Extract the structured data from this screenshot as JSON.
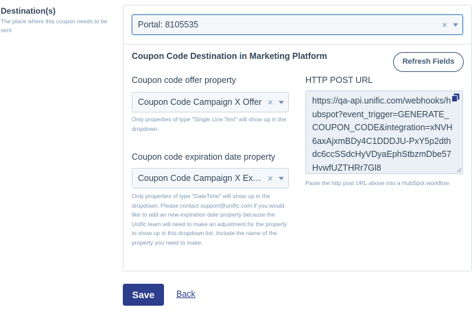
{
  "destination": {
    "title": "Destination(s)",
    "description": "The place where this coupon needs to be sent"
  },
  "portal_select": {
    "value": "Portal: 8105535",
    "clear_glyph": "×"
  },
  "section": {
    "title": "Coupon Code Destination in Marketing Platform"
  },
  "refresh_button": {
    "label": "Refresh Fields"
  },
  "offer_property": {
    "label": "Coupon code offer property",
    "value": "Coupon Code Campaign X Offer",
    "clear_glyph": "×",
    "help": "Only properties of type \"Single Line Text\" will show up in the dropdown."
  },
  "expiration_property": {
    "label": "Coupon code expiration date property",
    "value": "Coupon Code Campaign X Expiration Date",
    "clear_glyph": "×",
    "help": "Only properties of type \"DateTime\" will show up in the dropdown. Please contact support@unific.com if you would like to add an new expiration date property because the Unific team will need to make an adjustment for the property to show up in this dropdown list. Include the name of the property you need to make."
  },
  "http_post": {
    "label": "HTTP POST URL",
    "url": "https://qa-api.unific.com/webhooks/hubspot?event_trigger=GENERATE_COUPON_CODE&integration=xNVH6axAjxmBDy4C1DDDJU-PxY5p2dthdc6ccSSdcHyVDyaEphStbzmDbe57HvwfUZTHRr7Gl8",
    "help": "Paste the http post URL above into a HubSpot workflow"
  },
  "actions": {
    "save_label": "Save",
    "back_label": "Back"
  },
  "colors": {
    "primary": "#2d3e8c",
    "text": "#33475b",
    "muted": "#7c98b6",
    "border": "#dfe3eb",
    "input_bg": "#f5f8fa"
  }
}
